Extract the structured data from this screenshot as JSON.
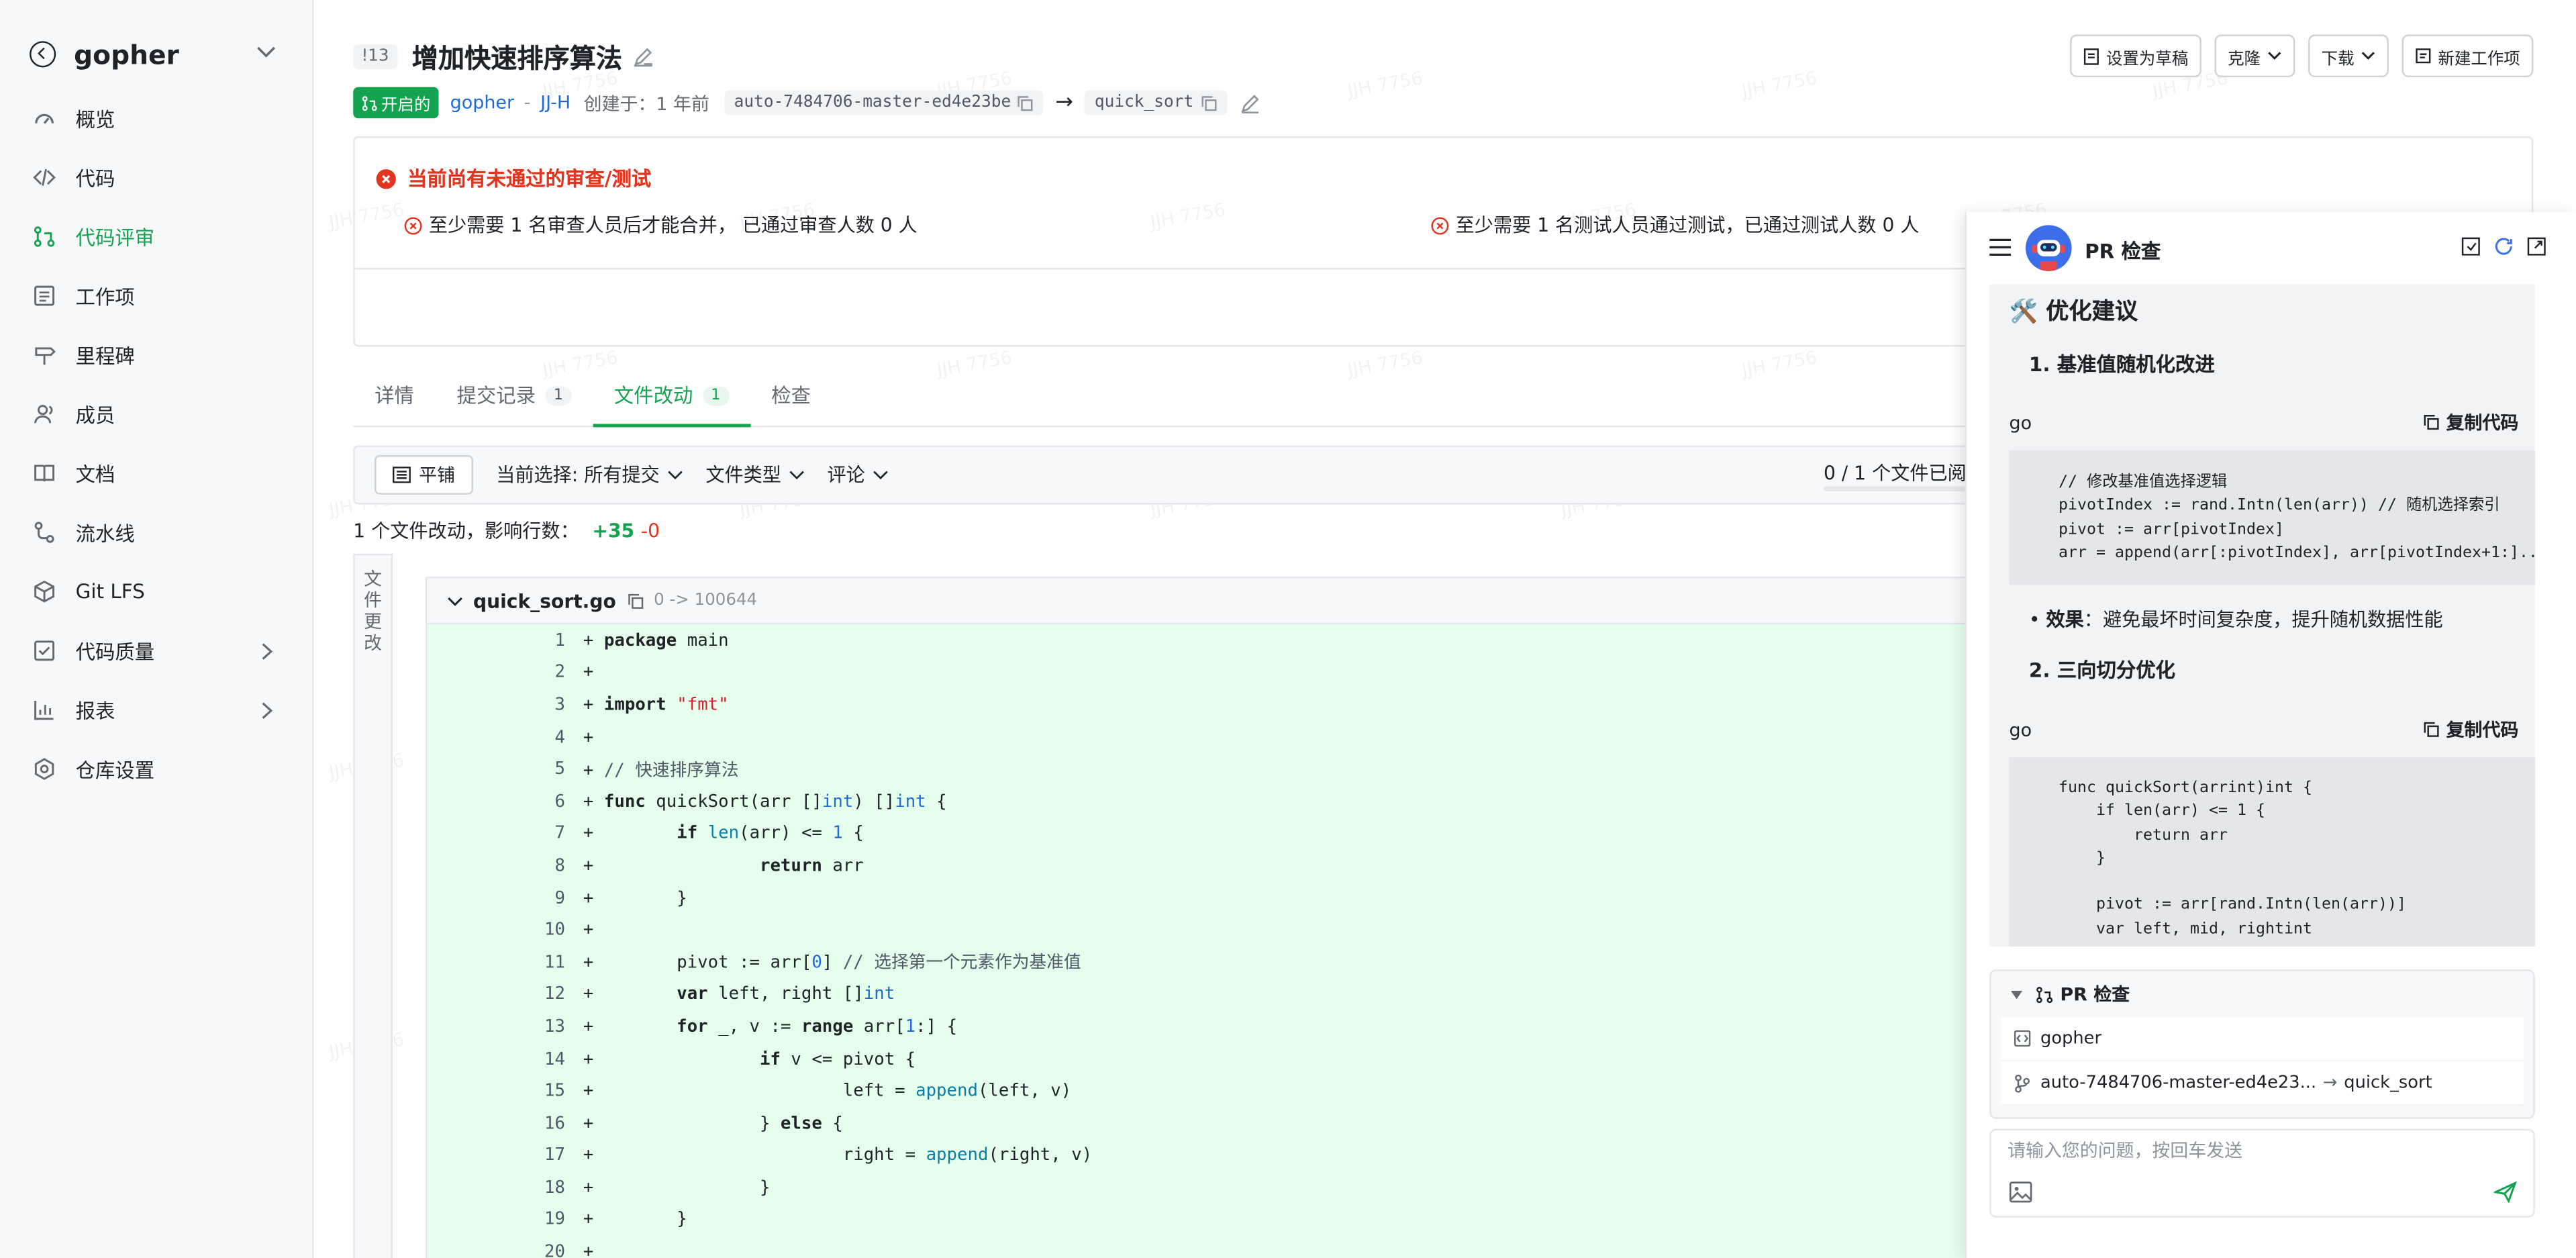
{
  "sidebar": {
    "project_name": "gopher",
    "items": [
      {
        "label": "概览",
        "icon": "dashboard-icon"
      },
      {
        "label": "代码",
        "icon": "code-icon"
      },
      {
        "label": "代码评审",
        "icon": "merge-request-icon",
        "active": true
      },
      {
        "label": "工作项",
        "icon": "workitem-icon"
      },
      {
        "label": "里程碑",
        "icon": "milestone-icon"
      },
      {
        "label": "成员",
        "icon": "members-icon"
      },
      {
        "label": "文档",
        "icon": "docs-icon"
      },
      {
        "label": "流水线",
        "icon": "pipeline-icon"
      },
      {
        "label": "Git LFS",
        "icon": "lfs-icon"
      },
      {
        "label": "代码质量",
        "icon": "quality-icon",
        "expandable": true
      },
      {
        "label": "报表",
        "icon": "report-icon",
        "expandable": true
      },
      {
        "label": "仓库设置",
        "icon": "settings-icon"
      }
    ]
  },
  "header": {
    "pr_number": "!13",
    "title": "增加快速排序算法",
    "status": "开启的",
    "repo": "gopher",
    "author": "JJ-H",
    "created_label": "创建于：",
    "created_time": "1 年前",
    "source_branch": "auto-7484706-master-ed4e23be",
    "arrow": "→",
    "target_branch": "quick_sort",
    "actions": {
      "draft": "设置为草稿",
      "clone": "克隆",
      "download": "下载",
      "new_workitem": "新建工作项"
    }
  },
  "review": {
    "headline": "当前尚有未通过的审查/测试",
    "rule_review": "至少需要 1 名审查人员后才能合并， 已通过审查人数 0 人",
    "rule_test": "至少需要 1 名测试人员通过测试，已通过测试人数 0 人"
  },
  "tabs": [
    {
      "label": "详情"
    },
    {
      "label": "提交记录",
      "count": "1"
    },
    {
      "label": "文件改动",
      "count": "1",
      "active": true
    },
    {
      "label": "检查"
    }
  ],
  "filter": {
    "flat_label": "平铺",
    "current_selection": "当前选择: 所有提交",
    "file_type": "文件类型",
    "comments": "评论",
    "viewed": "0 / 1 个文件已阅"
  },
  "stats": {
    "summary": "1 个文件改动，影响行数：",
    "added": "+35",
    "removed": "-0"
  },
  "file_tree_label": [
    "文",
    "件",
    "更",
    "改"
  ],
  "diff": {
    "filename": "quick_sort.go",
    "mode": "0 -> 100644",
    "lines": [
      {
        "n": "1",
        "html": "package main"
      },
      {
        "n": "2",
        "html": ""
      },
      {
        "n": "3",
        "html": "import \"fmt\""
      },
      {
        "n": "4",
        "html": ""
      },
      {
        "n": "5",
        "html": "// 快速排序算法"
      },
      {
        "n": "6",
        "html": "func quickSort(arr []int) []int {"
      },
      {
        "n": "7",
        "html": "       if len(arr) <= 1 {"
      },
      {
        "n": "8",
        "html": "               return arr"
      },
      {
        "n": "9",
        "html": "       }"
      },
      {
        "n": "10",
        "html": ""
      },
      {
        "n": "11",
        "html": "       pivot := arr[0] // 选择第一个元素作为基准值"
      },
      {
        "n": "12",
        "html": "       var left, right []int"
      },
      {
        "n": "13",
        "html": "       for _, v := range arr[1:] {"
      },
      {
        "n": "14",
        "html": "               if v <= pivot {"
      },
      {
        "n": "15",
        "html": "                       left = append(left, v)"
      },
      {
        "n": "16",
        "html": "               } else {"
      },
      {
        "n": "17",
        "html": "                       right = append(right, v)"
      },
      {
        "n": "18",
        "html": "               }"
      },
      {
        "n": "19",
        "html": "       }"
      },
      {
        "n": "20",
        "html": ""
      }
    ]
  },
  "panel": {
    "title": "PR 检查",
    "section_title": "🛠️ 优化建议",
    "item1": "1. 基准值随机化改进",
    "lang1": "go",
    "copy_label": "复制代码",
    "code1": "// 修改基准值选择逻辑\npivotIndex := rand.Intn(len(arr)) // 随机选择索引\npivot := arr[pivotIndex]\narr = append(arr[:pivotIndex], arr[pivotIndex+1:]...)",
    "bullet_key": "效果",
    "bullet_text": "：避免最坏时间复杂度，提升随机数据性能",
    "item2": "2. 三向切分优化",
    "lang2": "go",
    "code2": "func quickSort(arrint)int {\n    if len(arr) <= 1 {\n        return arr\n    }\n\n    pivot := arr[rand.Intn(len(arr))]\n    var left, mid, rightint",
    "ctx_title": "PR 检查",
    "ctx_repo": "gopher",
    "ctx_source": "auto-7484706-master-ed4e23...",
    "ctx_target": "quick_sort",
    "input_placeholder": "请输入您的问题，按回车发送"
  },
  "watermark": "JJH 7756",
  "colors": {
    "accent": "#14a34e",
    "danger": "#e0361f",
    "link": "#1f6bd6",
    "diff_add_bg": "#e6ffec"
  }
}
